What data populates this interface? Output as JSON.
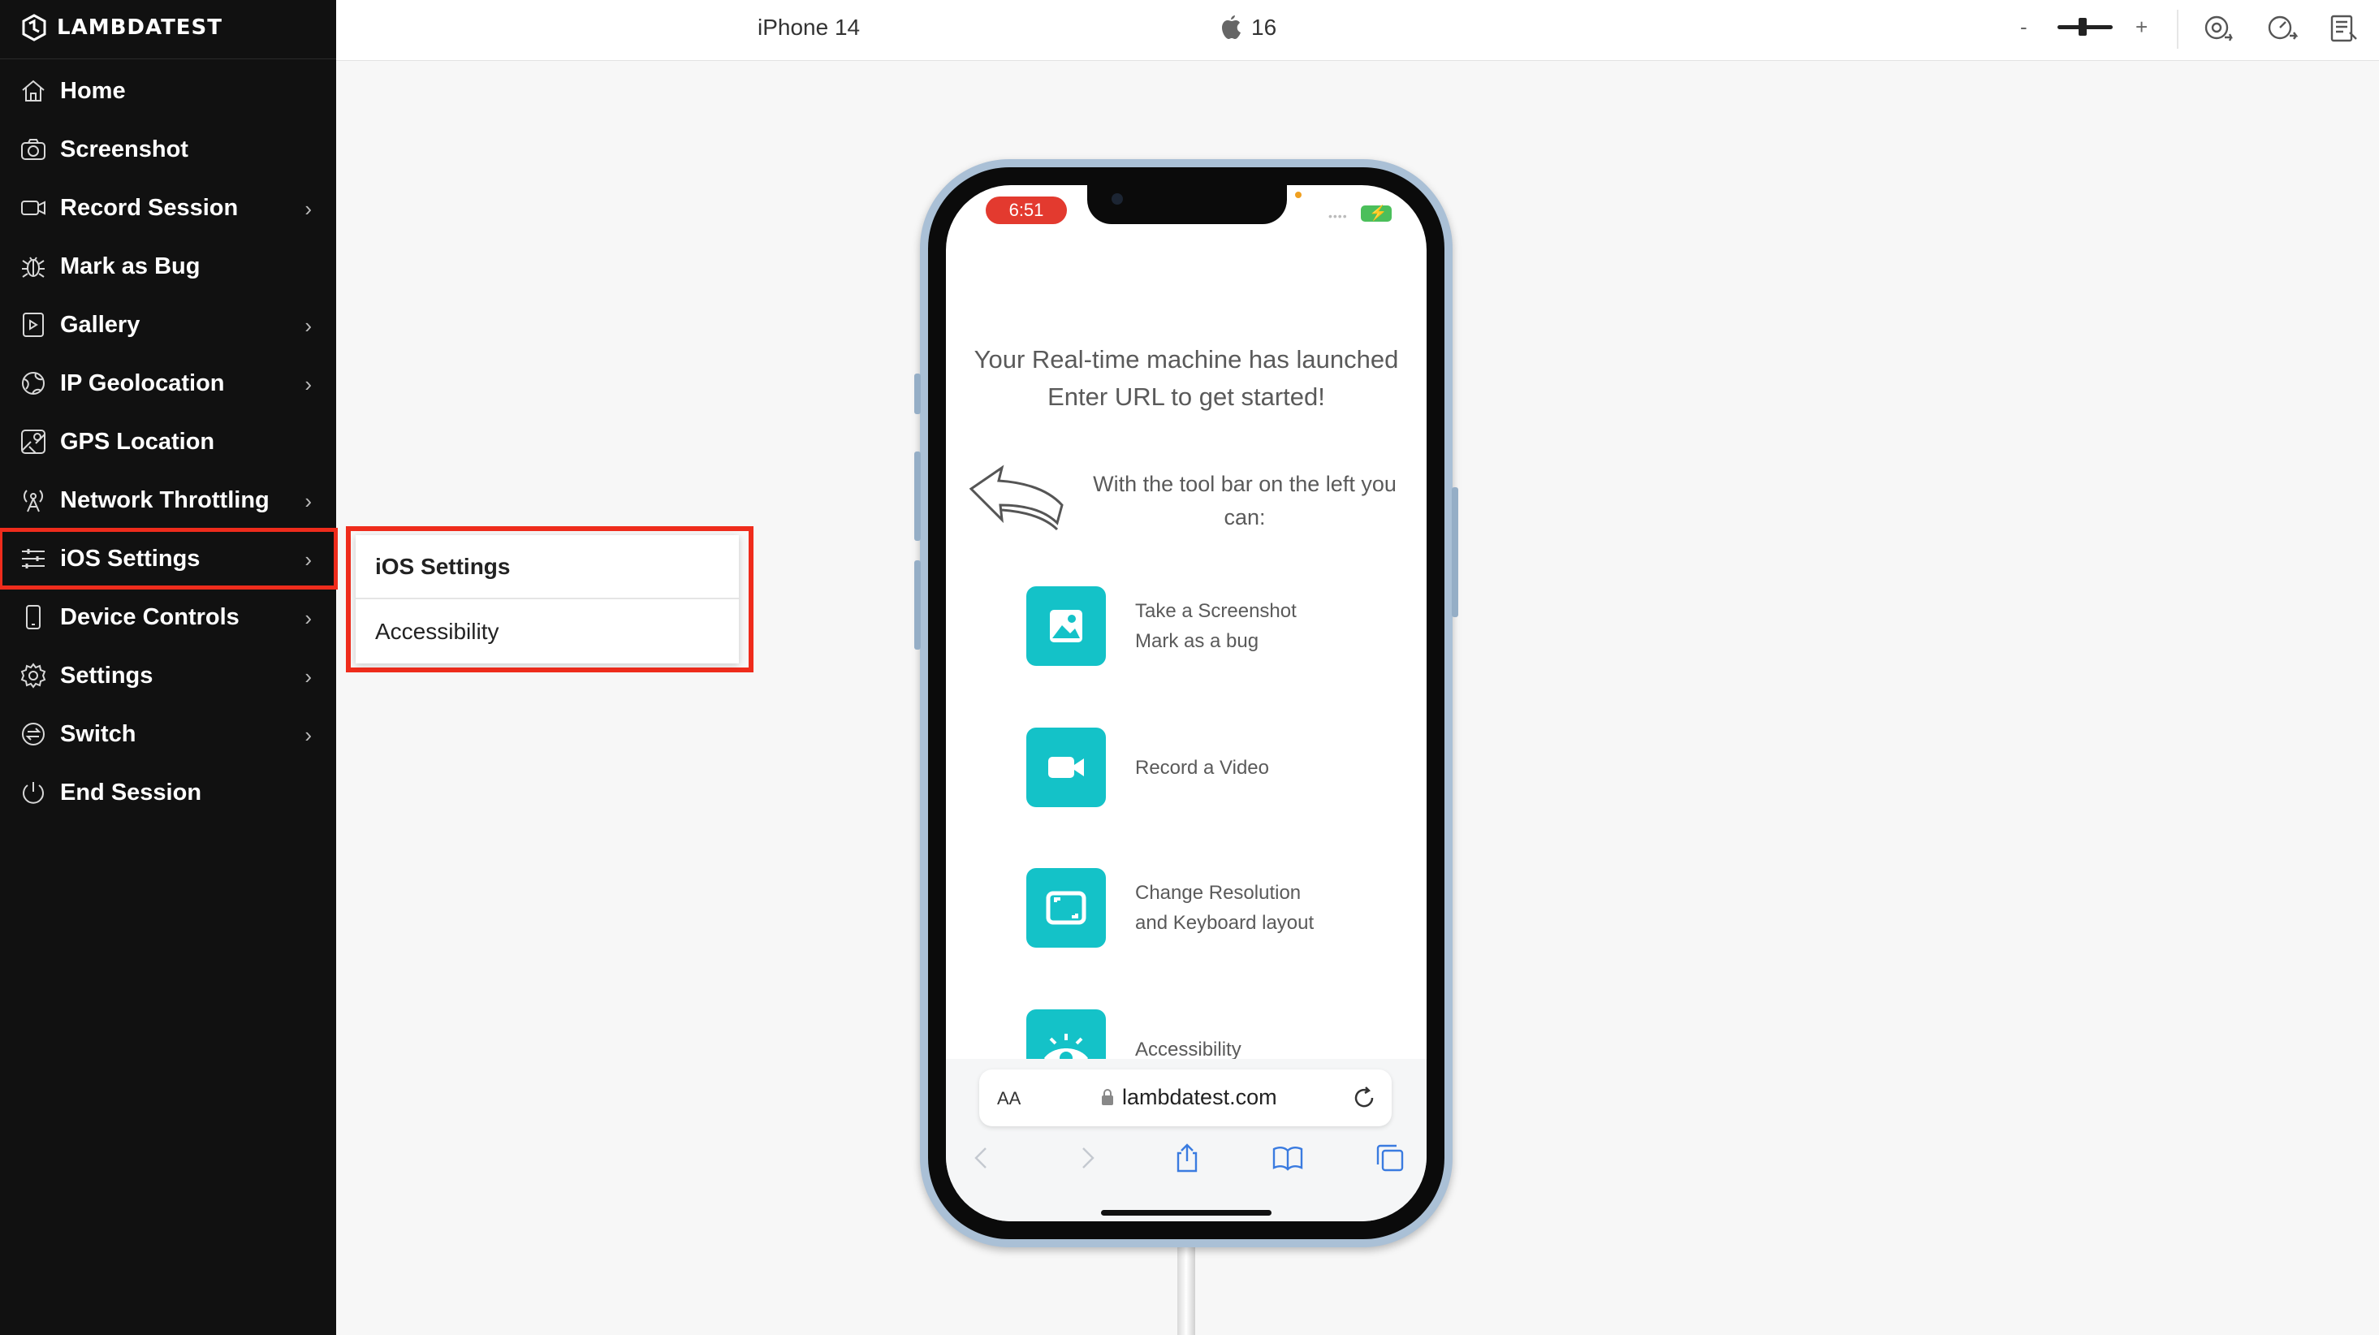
{
  "brand": {
    "name": "LAMBDATEST",
    "logo_icon": "lambdatest-logo"
  },
  "sidebar": {
    "items": [
      {
        "label": "Home",
        "icon": "home-icon",
        "has_submenu": false
      },
      {
        "label": "Screenshot",
        "icon": "camera-icon",
        "has_submenu": false
      },
      {
        "label": "Record Session",
        "icon": "video-icon",
        "has_submenu": true
      },
      {
        "label": "Mark as Bug",
        "icon": "bug-icon",
        "has_submenu": false
      },
      {
        "label": "Gallery",
        "icon": "gallery-icon",
        "has_submenu": true
      },
      {
        "label": "IP Geolocation",
        "icon": "globe-icon",
        "has_submenu": true
      },
      {
        "label": "GPS Location",
        "icon": "map-icon",
        "has_submenu": false
      },
      {
        "label": "Network Throttling",
        "icon": "antenna-icon",
        "has_submenu": true
      },
      {
        "label": "iOS Settings",
        "icon": "sliders-icon",
        "has_submenu": true,
        "highlighted": true
      },
      {
        "label": "Device Controls",
        "icon": "phone-icon",
        "has_submenu": true
      },
      {
        "label": "Settings",
        "icon": "gear-icon",
        "has_submenu": true
      },
      {
        "label": "Switch",
        "icon": "switch-icon",
        "has_submenu": true
      },
      {
        "label": "End Session",
        "icon": "power-icon",
        "has_submenu": false
      }
    ],
    "chevron": "›",
    "highlight_color": "#ef2c1c"
  },
  "submenu": {
    "items": [
      "iOS Settings",
      "Accessibility"
    ]
  },
  "topbar": {
    "device": "iPhone 14",
    "os_icon": "apple-icon",
    "os_version": "16",
    "zoom_minus": "-",
    "zoom_plus": "+",
    "zoom_level": 0.4,
    "icons": [
      "rotate-icon",
      "gauge-icon",
      "logs-icon"
    ]
  },
  "phone": {
    "time": "6:51",
    "status_dots": "••••",
    "battery_icon": "battery-charging-icon",
    "headline": "Your Real-time machine has launched Enter URL to get started!",
    "intro": "With the tool bar on the left you can:",
    "features": [
      {
        "icon": "image-icon",
        "lines": [
          "Take a Screenshot",
          "Mark as a bug"
        ]
      },
      {
        "icon": "video-icon",
        "lines": [
          "Record a Video"
        ]
      },
      {
        "icon": "resize-icon",
        "lines": [
          "Change Resolution",
          "and Keyboard layout"
        ]
      },
      {
        "icon": "eye-icon",
        "lines": [
          "Accessibility"
        ]
      }
    ],
    "accent_color": "#14c2c8",
    "url_aa": "AA",
    "url": "lambdatest.com",
    "toolbar_icons": [
      "back-icon",
      "forward-icon",
      "share-icon",
      "bookmarks-icon",
      "tabs-icon"
    ]
  }
}
